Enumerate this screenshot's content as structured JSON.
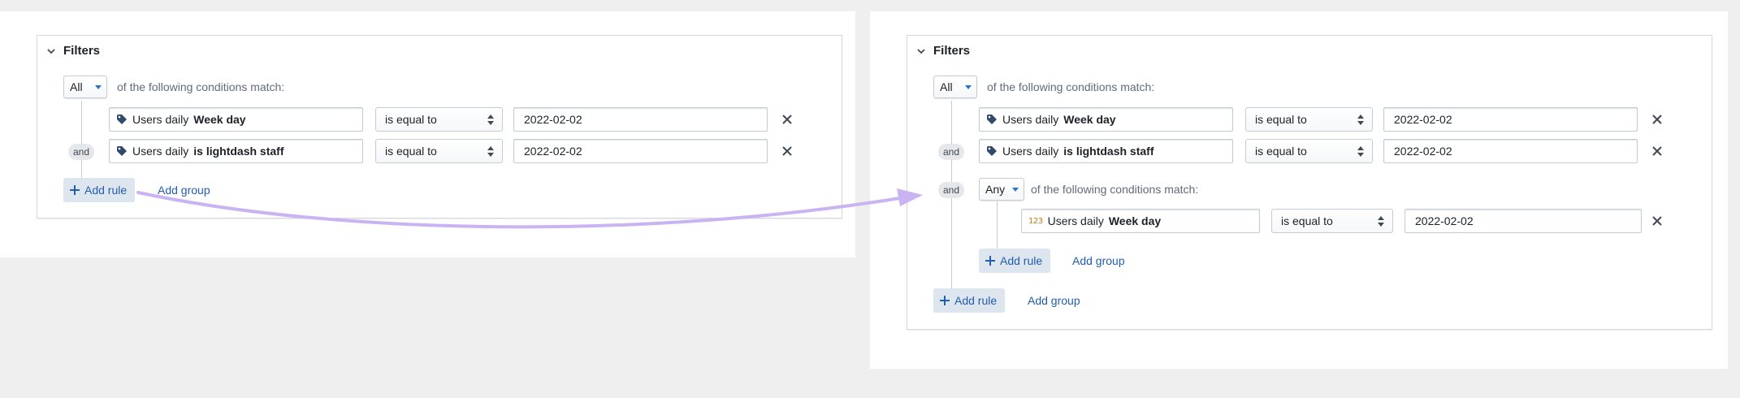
{
  "left": {
    "header": {
      "title": "Filters"
    },
    "group": {
      "match_mode": "All",
      "match_text": "of the following conditions match:"
    },
    "rules": [
      {
        "field_prefix": "Users daily",
        "field_name": "Week day",
        "operator": "is equal to",
        "value": "2022-02-02"
      },
      {
        "connector": "and",
        "field_prefix": "Users daily",
        "field_name": "is lightdash staff",
        "operator": "is equal to",
        "value": "2022-02-02"
      }
    ],
    "add_rule_label": "Add rule",
    "add_group_label": "Add group"
  },
  "right": {
    "header": {
      "title": "Filters"
    },
    "group": {
      "match_mode": "All",
      "match_text": "of the following conditions match:"
    },
    "rules": [
      {
        "field_prefix": "Users daily",
        "field_name": "Week day",
        "operator": "is equal to",
        "value": "2022-02-02"
      },
      {
        "connector": "and",
        "field_prefix": "Users daily",
        "field_name": "is lightdash staff",
        "operator": "is equal to",
        "value": "2022-02-02"
      }
    ],
    "nested": {
      "connector": "and",
      "match_mode": "Any",
      "match_text": "of the following conditions match:",
      "rule": {
        "type_badge": "123",
        "field_prefix": "Users daily",
        "field_name": "Week day",
        "operator": "is equal to",
        "value": "2022-02-02"
      },
      "add_rule_label": "Add rule",
      "add_group_label": "Add group"
    },
    "add_rule_label": "Add rule",
    "add_group_label": "Add group"
  },
  "icons": {
    "collapse": "chevron-down-icon",
    "field_dimension": "tag-icon",
    "field_number": "number-type-icon",
    "operator": "double-caret-icon",
    "remove": "close-icon",
    "add": "plus-icon"
  },
  "colors": {
    "accent": "#2d72d2",
    "link": "#215db0",
    "add_button_bg": "#dde5ee",
    "annotation_arrow": "#c9b3f2"
  }
}
